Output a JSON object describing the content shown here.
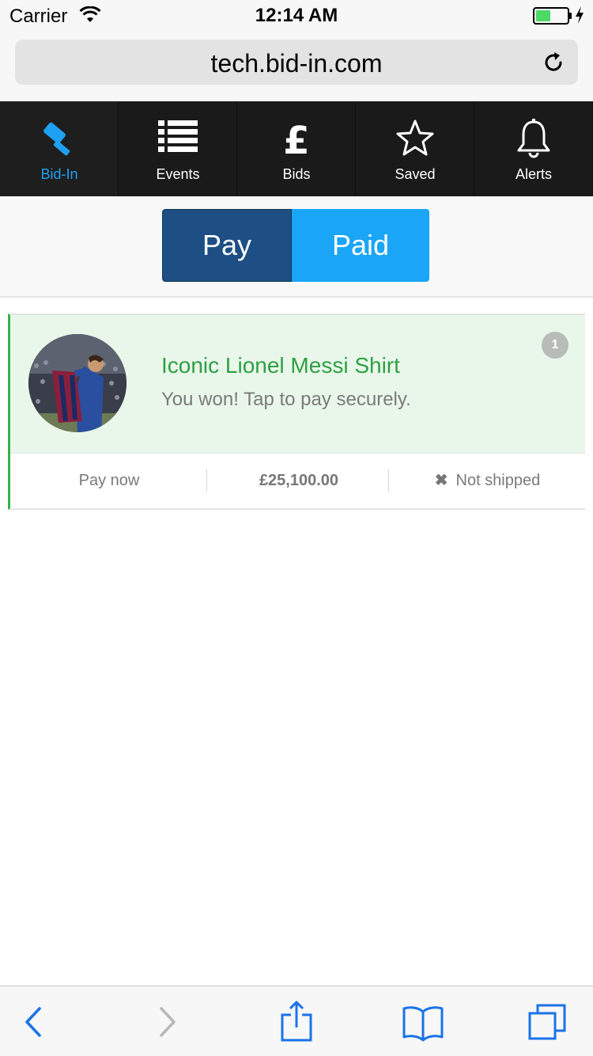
{
  "status_bar": {
    "carrier": "Carrier",
    "time": "12:14 AM",
    "battery_color": "#4cd964",
    "icons": [
      "wifi-icon",
      "battery-icon",
      "charging-bolt-icon"
    ]
  },
  "browser": {
    "url": "tech.bid-in.com",
    "reload_icon": "reload-icon"
  },
  "nav": {
    "items": [
      {
        "label": "Bid-In",
        "icon": "gavel-icon",
        "active": true
      },
      {
        "label": "Events",
        "icon": "list-icon",
        "active": false
      },
      {
        "label": "Bids",
        "icon": "pound-icon",
        "active": false
      },
      {
        "label": "Saved",
        "icon": "star-icon",
        "active": false
      },
      {
        "label": "Alerts",
        "icon": "bell-icon",
        "active": false
      }
    ],
    "active_color": "#1ea1f2"
  },
  "toggle": {
    "pay_label": "Pay",
    "paid_label": "Paid",
    "selected": "Pay"
  },
  "item": {
    "title": "Iconic Lionel Messi Shirt",
    "subtitle": "You won! Tap to pay securely.",
    "badge": "1",
    "action": "Pay now",
    "price": "£25,100.00",
    "shipping": "Not shipped",
    "title_color": "#2ea043"
  },
  "toolbar": {
    "icons": [
      "back-icon",
      "forward-icon",
      "share-icon",
      "bookmarks-icon",
      "tabs-icon"
    ]
  }
}
